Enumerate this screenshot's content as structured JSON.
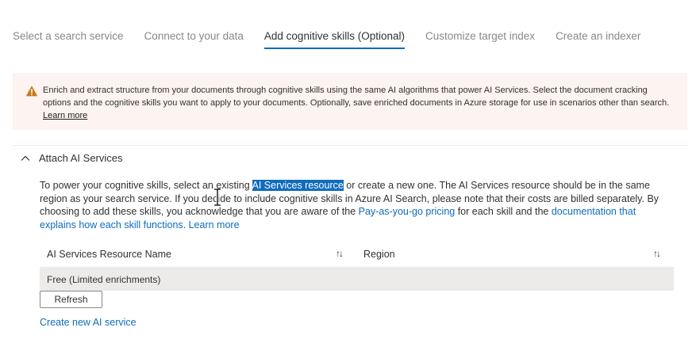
{
  "tabs": [
    {
      "label": "Select a search service",
      "active": false
    },
    {
      "label": "Connect to your data",
      "active": false
    },
    {
      "label": "Add cognitive skills (Optional)",
      "active": true
    },
    {
      "label": "Customize target index",
      "active": false
    },
    {
      "label": "Create an indexer",
      "active": false
    }
  ],
  "banner": {
    "icon": "warning-icon",
    "text": "Enrich and extract structure from your documents through cognitive skills using the same AI algorithms that power AI Services. Select the document cracking options and the cognitive skills you want to apply to your documents. Optionally, save enriched documents in Azure storage for use in scenarios other than search. ",
    "link": "Learn more"
  },
  "section": {
    "title": "Attach AI Services",
    "icon": "chevron-up-icon",
    "desc": {
      "p1": "To power your cognitive skills, select an existing ",
      "highlight": "AI Services resource",
      "p2": " or create a new one. The AI Services resource should be in the same region as your search service. If you decide to include cognitive skills in Azure AI Search, please note that their costs are billed separately. By choosing to add these skills, you acknowledge that you are aware of the ",
      "link1": "Pay-as-you-go pricing",
      "p3": " for each skill and the ",
      "link2": "documentation that explains how each skill functions. Learn more"
    }
  },
  "grid": {
    "col_name": "AI Services Resource Name",
    "col_region": "Region",
    "sort_glyph": "↑↓",
    "rows": [
      {
        "name": "Free (Limited enrichments)",
        "region": ""
      }
    ]
  },
  "refresh_label": "Refresh",
  "create_link": "Create new AI service",
  "colors": {
    "accent": "#0f6cbd",
    "banner_bg": "#fdf3f0",
    "warning": "#c87a1a"
  }
}
